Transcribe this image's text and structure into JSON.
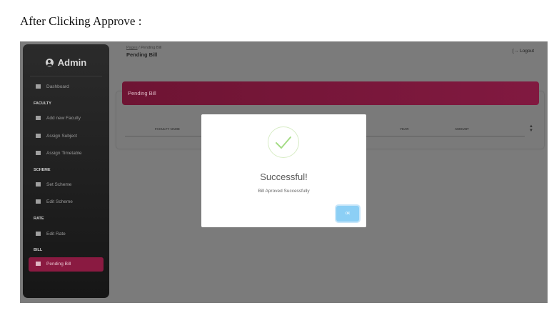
{
  "caption": "After Clicking Approve :",
  "sidebar": {
    "brand": "Admin",
    "items": [
      {
        "type": "item",
        "label": "Dashboard"
      },
      {
        "type": "section",
        "label": "FACULTY"
      },
      {
        "type": "item",
        "label": "Add new Faculty"
      },
      {
        "type": "item",
        "label": "Assign Subject"
      },
      {
        "type": "item",
        "label": "Assign Timetable"
      },
      {
        "type": "section",
        "label": "SCHEME"
      },
      {
        "type": "item",
        "label": "Set Scheme"
      },
      {
        "type": "item",
        "label": "Edit Scheme"
      },
      {
        "type": "section",
        "label": "RATE"
      },
      {
        "type": "item",
        "label": "Edit Rate"
      },
      {
        "type": "section",
        "label": "BILL"
      },
      {
        "type": "item",
        "label": "Pending Bill",
        "active": true
      }
    ]
  },
  "header": {
    "breadcrumb_root": "Pages",
    "breadcrumb_sep": "/",
    "breadcrumb_current": "Pending Bill",
    "page_title": "Pending Bill",
    "logout_label": "Logout"
  },
  "card": {
    "title": "Pending Bill",
    "columns": [
      "FACULTY NAME",
      "YEAR",
      "AMOUNT"
    ]
  },
  "modal": {
    "title": "Successful!",
    "message": "Bill Aproved Successfully",
    "ok_label": "ok"
  },
  "colors": {
    "accent": "#8a1a41",
    "ok_button": "#8ccff5",
    "success_check": "#a5dc86"
  }
}
